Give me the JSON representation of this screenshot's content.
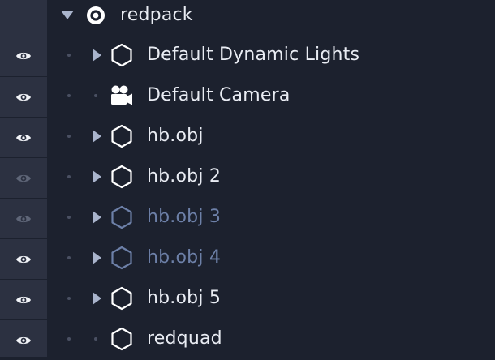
{
  "root": {
    "label": "redpack",
    "icon": "target-icon",
    "expanded": true
  },
  "items": [
    {
      "label": "Default Dynamic Lights",
      "icon": "hexagon-icon",
      "expandable": true,
      "visible": true,
      "dim": false
    },
    {
      "label": "Default Camera",
      "icon": "camera-icon",
      "expandable": false,
      "visible": true,
      "dim": false
    },
    {
      "label": "hb.obj",
      "icon": "hexagon-icon",
      "expandable": true,
      "visible": true,
      "dim": false
    },
    {
      "label": "hb.obj 2",
      "icon": "hexagon-icon",
      "expandable": true,
      "visible": false,
      "dim": false
    },
    {
      "label": "hb.obj 3",
      "icon": "hexagon-icon",
      "expandable": true,
      "visible": false,
      "dim": true
    },
    {
      "label": "hb.obj 4",
      "icon": "hexagon-icon",
      "expandable": true,
      "visible": true,
      "dim": true
    },
    {
      "label": "hb.obj 5",
      "icon": "hexagon-icon",
      "expandable": true,
      "visible": true,
      "dim": false
    },
    {
      "label": "redquad",
      "icon": "hexagon-icon",
      "expandable": false,
      "visible": true,
      "dim": false
    }
  ],
  "colors": {
    "panel": "#1c212e",
    "visibility_column": "#2c3141",
    "text": "#e9ecf3",
    "text_dim": "#6d80a8",
    "eye_on": "#f2f4f8",
    "eye_off": "#5f6678"
  }
}
